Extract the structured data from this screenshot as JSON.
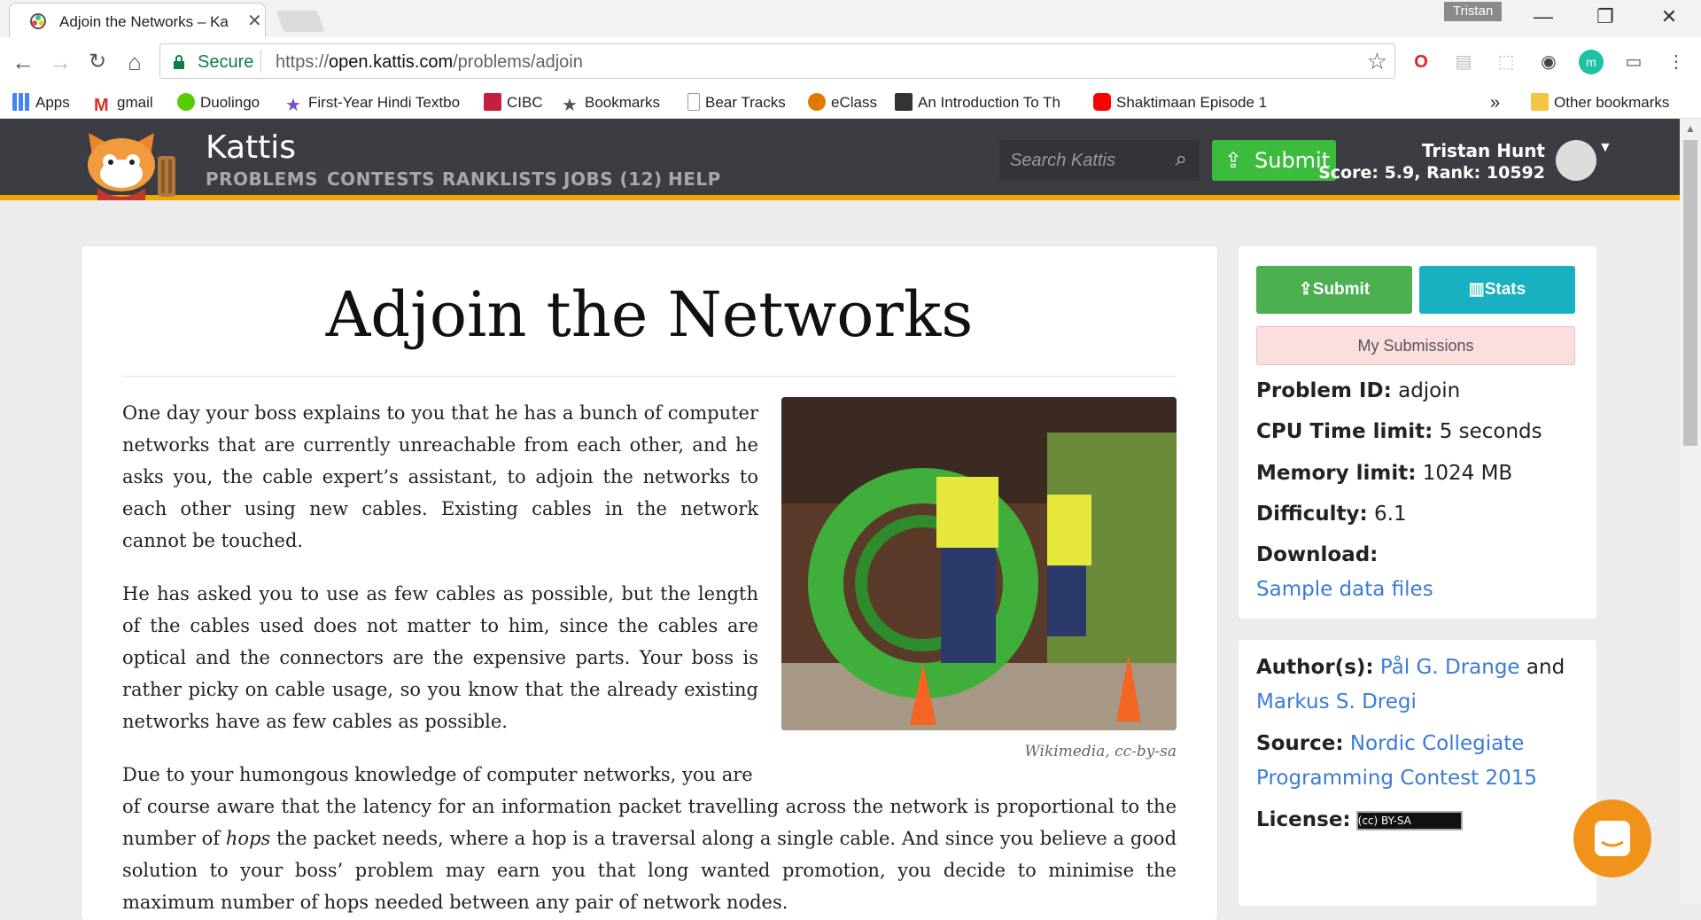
{
  "browser": {
    "tab_title": "Adjoin the Networks – Ka",
    "tab_close": "✕",
    "profile_name": "Tristan",
    "window_controls": {
      "minimize": "—",
      "restore": "❐",
      "close": "✕"
    },
    "secure_label": "Secure",
    "url_scheme": "https://",
    "url_host": "open.kattis.com",
    "url_path": "/problems/adjoin",
    "bookmarks": [
      {
        "label": "Apps",
        "icon": "apps-grid-icon",
        "color": "#4285f4"
      },
      {
        "label": "gmail",
        "icon": "gmail-icon",
        "color": "#d93025"
      },
      {
        "label": "Duolingo",
        "icon": "duolingo-icon",
        "color": "#58cc02"
      },
      {
        "label": "First-Year Hindi Textbo",
        "icon": "star-icon",
        "color": "#7b4fc4"
      },
      {
        "label": "CIBC",
        "icon": "cibc-icon",
        "color": "#c41f3e"
      },
      {
        "label": "Bookmarks",
        "icon": "star-icon",
        "color": "#555555"
      },
      {
        "label": "Bear Tracks",
        "icon": "page-icon",
        "color": "#bbbbbb"
      },
      {
        "label": "eClass",
        "icon": "eclass-icon",
        "color": "#e07b00"
      },
      {
        "label": "An Introduction To Th",
        "icon": "sql-icon",
        "color": "#333333"
      },
      {
        "label": "Shaktimaan Episode 1",
        "icon": "youtube-icon",
        "color": "#ff0000"
      }
    ],
    "bookmarks_more": "»",
    "other_bookmarks": "Other bookmarks"
  },
  "site": {
    "brand": "Kattis",
    "nav": [
      "PROBLEMS",
      "CONTESTS",
      "RANKLISTS",
      "JOBS (12)",
      "HELP"
    ],
    "search_placeholder": "Search Kattis",
    "submit_label": "Submit",
    "user_name": "Tristan Hunt",
    "user_score": "Score: 5.9, Rank: 10592",
    "accent_color": "#f0a500"
  },
  "problem": {
    "title": "Adjoin the Networks",
    "paragraphs": [
      "One day your boss explains to you that he has a bunch of computer networks that are currently unreachable from each other, and he asks you, the cable expert’s assistant, to adjoin the networks to each other using new cables. Existing cables in the network cannot be touched.",
      "He has asked you to use as few cables as possible, but the length of the cables used does not matter to him, since the cables are optical and the connectors are the expensive parts. Your boss is rather picky on cable usage, so you know that the already existing networks have as few cables as possible.",
      "Due to your humongous knowledge of computer networks, you are"
    ],
    "para3_rest_a": "of course aware that the latency for an information packet travelling across the network is proportional to the number of ",
    "para3_hops": "hops",
    "para3_rest_b": " the packet needs, where a hop is a traversal along a single cable. And since you believe a good solution to your boss’ problem may earn you that long wanted promotion, you decide to minimise the maximum number of hops needed between any pair of network nodes.",
    "image_caption": "Wikimedia, cc-by-sa"
  },
  "sidebar": {
    "submit": "Submit",
    "stats": "Stats",
    "my_submissions": "My Submissions",
    "problem_id_label": "Problem ID:",
    "problem_id": "adjoin",
    "cpu_label": "CPU Time limit:",
    "cpu": "5 seconds",
    "mem_label": "Memory limit:",
    "mem": "1024 MB",
    "difficulty_label": "Difficulty:",
    "difficulty": "6.1",
    "download_label": "Download:",
    "download_link": "Sample data files",
    "authors_label": "Author(s):",
    "author1": "Pål G. Drange",
    "and": "and",
    "author2": "Markus S. Dregi",
    "source_label": "Source:",
    "source1": "Nordic Collegiate",
    "source2": "Programming Contest 2015",
    "license_label": "License:",
    "license_badge": "(cc) BY-SA"
  }
}
